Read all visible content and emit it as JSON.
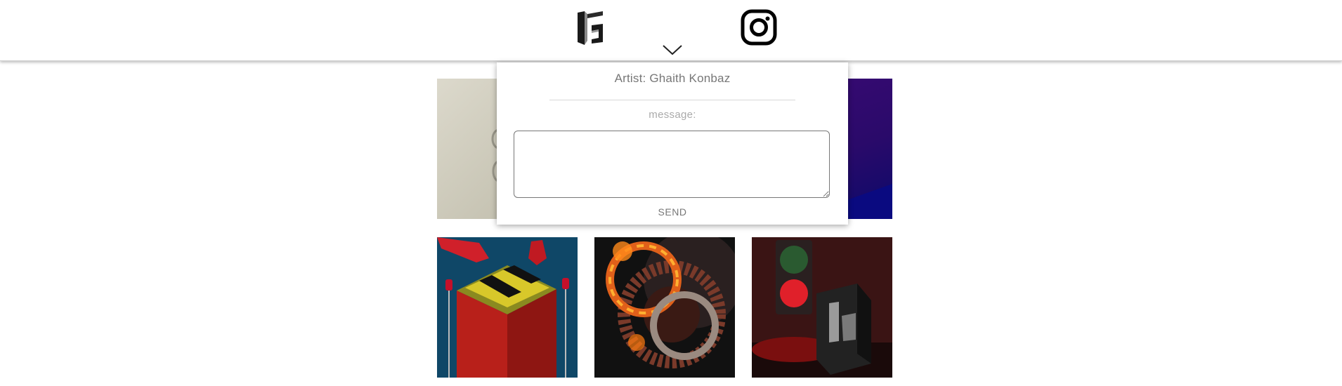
{
  "header": {
    "logo_icon": "kg-monogram-logo",
    "social_icon": "instagram-icon",
    "toggle_icon": "chevron-down-icon"
  },
  "contact_form": {
    "artist_label": "Artist: Ghaith Konbaz",
    "message_label": "message:",
    "message_value": "",
    "send_label": "SEND"
  },
  "gallery": {
    "tiles": [
      {
        "subject": "white-abstract-render"
      },
      {
        "subject": "purple-gradient-render"
      },
      {
        "subject": "red-block-with-caution-stripes"
      },
      {
        "subject": "flaming-gears"
      },
      {
        "subject": "traffic-light-and-kg-cube"
      }
    ]
  },
  "colors": {
    "text_gray": "#777777",
    "label_gray": "#aaaaaa",
    "header_bg": "#ffffff"
  }
}
